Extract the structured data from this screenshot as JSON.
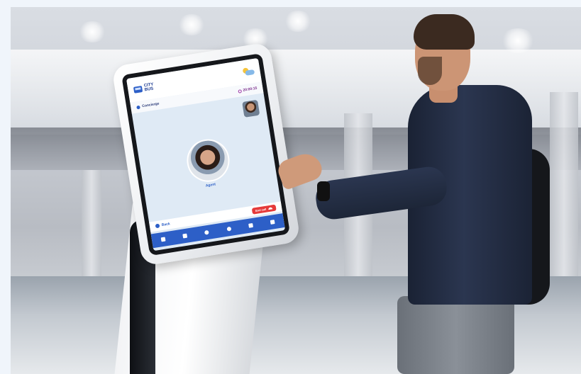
{
  "kiosk_screen": {
    "logo_line1": "CITY",
    "logo_line2": "BUS",
    "weather_icon": "weather-sun-cloud-icon",
    "concierge_label": "Concierge",
    "time": "20:00:15",
    "agent_label": "Agent",
    "back_label": "Back",
    "end_call_label": "End call",
    "nav_icons": [
      "home-icon",
      "bus-icon",
      "support-icon",
      "location-icon",
      "ticket-icon",
      "car-icon"
    ]
  },
  "colors": {
    "brand_blue": "#2d5fc7",
    "end_call_red": "#e53a3a",
    "screen_bg": "#dfeaf5"
  }
}
